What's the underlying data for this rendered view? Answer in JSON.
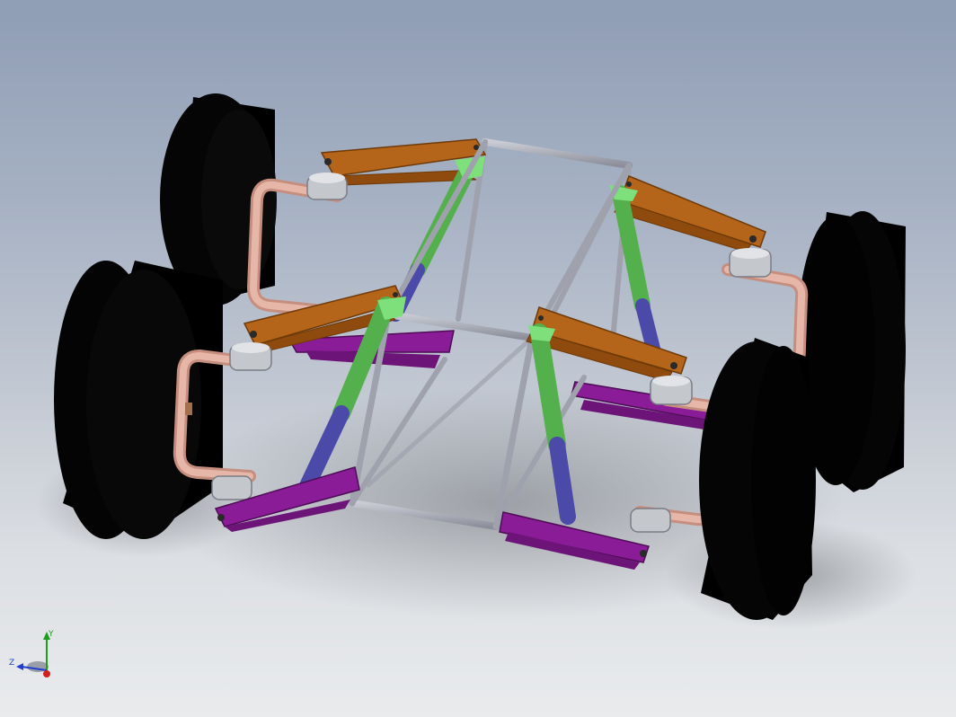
{
  "view": {
    "type": "3d-cad-model-viewport",
    "model": "suspension-frame-assembly"
  },
  "colors": {
    "background_top": "#8f9db5",
    "background_bottom": "#e9ebed",
    "tire": "#050505",
    "upper_a_arm": "#a85a0c",
    "lower_a_arm": "#8a1c97",
    "frame_tube": "#a6a9b4",
    "shock_spring": "#54b04c",
    "shock_body": "#4b4aa8",
    "upright": "#d6a596",
    "ball_joint": "#c4c7cc",
    "mount_tab": "#7ee07a"
  },
  "triad": {
    "x_label": "",
    "y_label": "Y",
    "z_label": "Z",
    "y_color": "#1f9b1f",
    "z_color": "#1f3fcc",
    "x_color": "#d21f1f"
  }
}
